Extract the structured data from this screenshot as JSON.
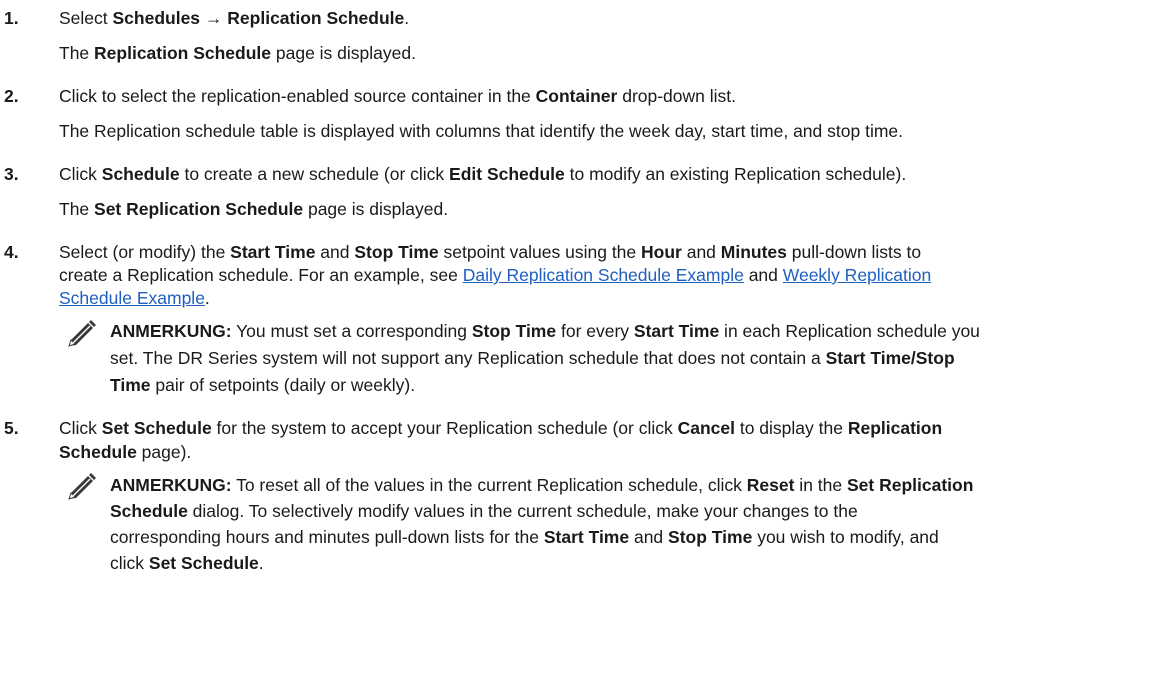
{
  "steps": [
    {
      "number": "1.",
      "line1": {
        "pre": "Select ",
        "b1": "Schedules",
        "arrow": " → ",
        "b2": "Replication Schedule",
        "post": "."
      },
      "line2": {
        "pre": "The ",
        "b1": "Replication Schedule",
        "post": " page is displayed."
      }
    },
    {
      "number": "2.",
      "line1": {
        "pre": "Click to select the replication-enabled source container in the ",
        "b1": "Container",
        "post": " drop-down list."
      },
      "line2": {
        "text": "The Replication schedule table is displayed with columns that identify the week day, start time, and stop time."
      }
    },
    {
      "number": "3.",
      "line1": {
        "pre": "Click ",
        "b1": "Schedule",
        "mid": " to create a new schedule (or click ",
        "b2": "Edit Schedule",
        "post": " to modify an existing Replication schedule)."
      },
      "line2": {
        "pre": "The ",
        "b1": "Set Replication Schedule",
        "post": " page is displayed."
      }
    },
    {
      "number": "4.",
      "line1": {
        "pre": "Select (or modify) the ",
        "b1": "Start Time",
        "mid1": " and ",
        "b2": "Stop Time",
        "mid2": " setpoint values using the ",
        "b3": "Hour",
        "mid3": " and ",
        "b4": "Minutes",
        "post": " pull-down lists to"
      },
      "line2": {
        "pre": "create a Replication schedule. For an example, see ",
        "link1": "Daily Replication Schedule Example",
        "mid": " and ",
        "link2a": "Weekly Replication"
      },
      "line3": {
        "link2b": "Schedule Example",
        "post": "."
      },
      "note": {
        "label": "ANMERKUNG:",
        "l1": {
          "pre": " You must set a corresponding ",
          "b1": "Stop Time",
          "mid": " for every ",
          "b2": "Start Time",
          "post": " in each Replication schedule you"
        },
        "l2": {
          "pre": "set. The DR Series system will not support any Replication schedule that does not contain a ",
          "b1": "Start Time/Stop"
        },
        "l3": {
          "b1": "Time",
          "post": " pair of setpoints (daily or weekly)."
        }
      }
    },
    {
      "number": "5.",
      "line1": {
        "pre": "Click ",
        "b1": "Set Schedule",
        "mid1": " for the system to accept your Replication schedule (or click ",
        "b2": "Cancel",
        "mid2": " to display the ",
        "b3": "Replication"
      },
      "line2": {
        "b1": "Schedule",
        "post": " page)."
      },
      "note": {
        "label": "ANMERKUNG:",
        "l1": {
          "pre": " To reset all of the values in the current Replication schedule, click ",
          "b1": "Reset",
          "mid": " in the ",
          "b2": "Set Replication"
        },
        "l2": {
          "b1": "Schedule",
          "post": " dialog. To selectively modify values in the current schedule, make your changes to the"
        },
        "l3": {
          "pre": "corresponding hours and minutes pull-down lists for the ",
          "b1": "Start Time",
          "mid1": " and ",
          "b2": "Stop Time",
          "post": " you wish to modify, and"
        },
        "l4": {
          "pre": "click ",
          "b1": "Set Schedule",
          "post": "."
        }
      }
    }
  ],
  "icons": {
    "note": "pencil-note-icon"
  }
}
